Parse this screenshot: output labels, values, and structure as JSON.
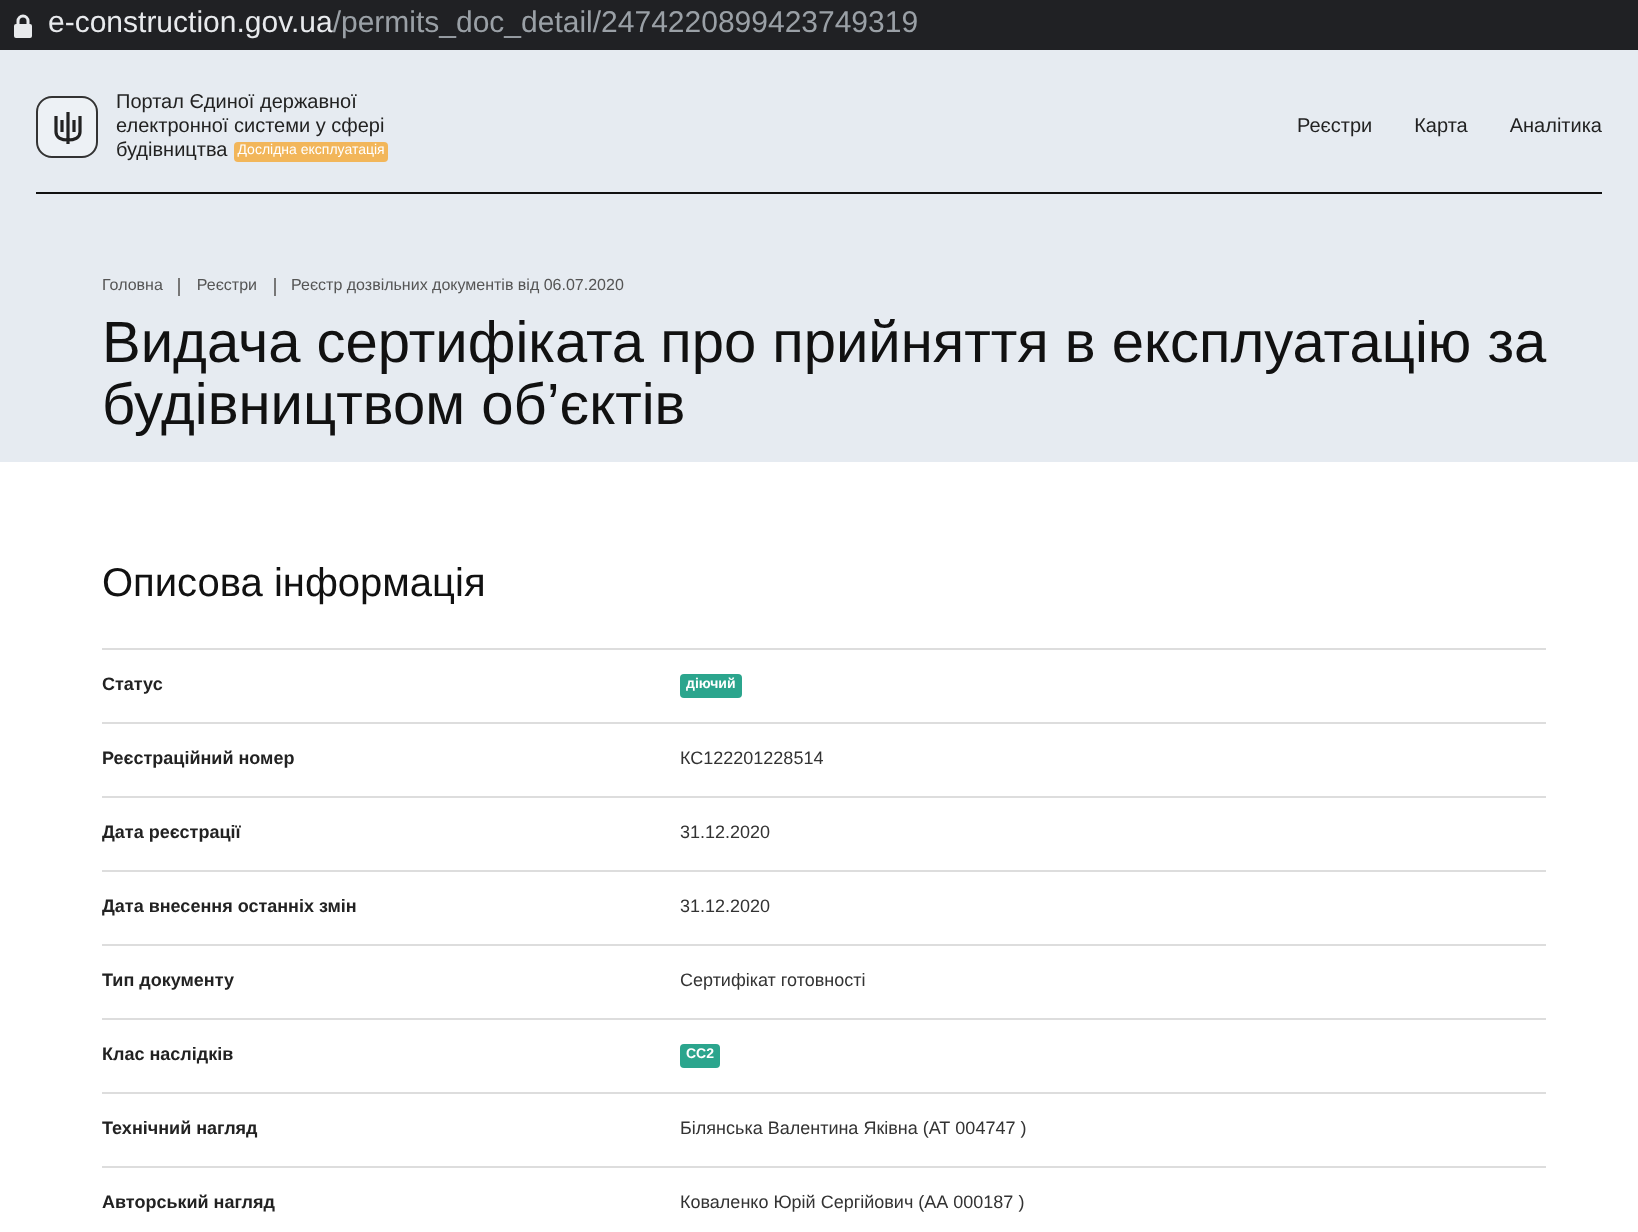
{
  "address_bar": {
    "domain": "e-construction.gov.ua",
    "path": "/permits_doc_detail/2474220899423749319"
  },
  "header": {
    "logo_lines": [
      "Портал Єдиної державної",
      "електронної системи у сфері",
      "будівництва"
    ],
    "badge": "Дослідна експлуатація",
    "nav": [
      "Реєстри",
      "Карта",
      "Аналітика"
    ]
  },
  "breadcrumbs": [
    "Головна",
    "Реєстри",
    "Реєстр дозвільних документів від 06.07.2020"
  ],
  "title": "Видача сертифіката про прийняття в експлуатацію за будівництвом об’єктів",
  "section_title": "Описова інформація",
  "rows": [
    {
      "label": "Статус",
      "value": "діючий",
      "kind": "badge"
    },
    {
      "label": "Реєстраційний номер",
      "value": "КС122201228514",
      "kind": "text"
    },
    {
      "label": "Дата реєстрації",
      "value": "31.12.2020",
      "kind": "text"
    },
    {
      "label": "Дата внесення останніх змін",
      "value": "31.12.2020",
      "kind": "text"
    },
    {
      "label": "Тип документу",
      "value": "Сертифікат готовності",
      "kind": "text"
    },
    {
      "label": "Клас наслідків",
      "value": "СС2",
      "kind": "badge"
    },
    {
      "label": "Технічний нагляд",
      "value": "Білянська Валентина Яківна (АТ 004747 )",
      "kind": "text"
    },
    {
      "label": "Авторський нагляд",
      "value": "Коваленко Юрій Сергійович (АА 000187 )",
      "kind": "text"
    }
  ]
}
